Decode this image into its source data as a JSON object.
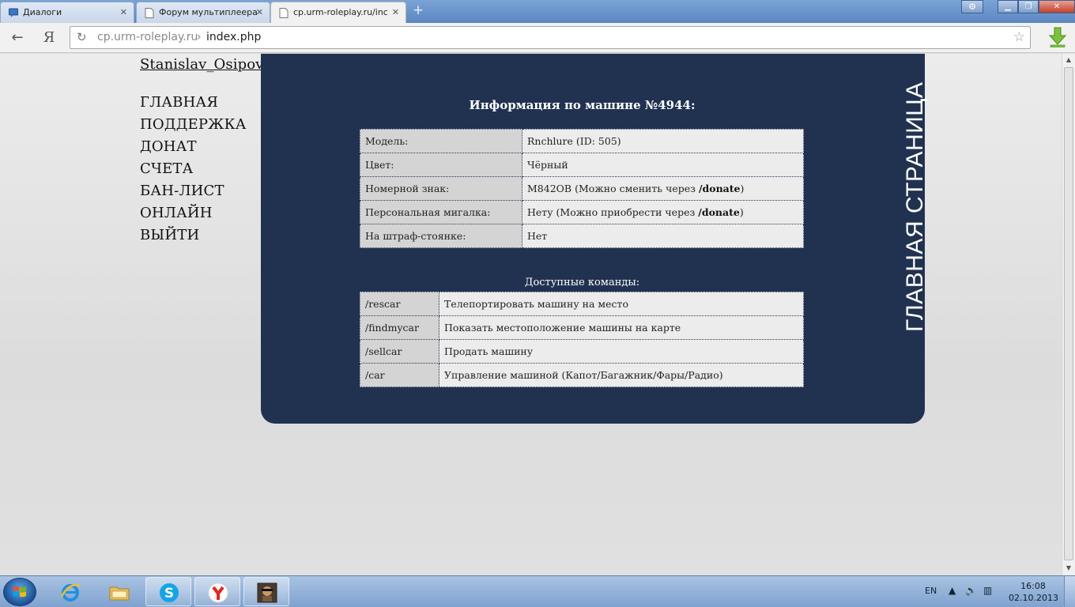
{
  "browser": {
    "tabs": [
      {
        "label": "Диалоги",
        "active": false
      },
      {
        "label": "Форум мультиплеера",
        "active": false
      },
      {
        "label": "cp.urm-roleplay.ru/inc",
        "active": true
      }
    ],
    "new_tab_symbol": "+",
    "url_host": "cp.urm-roleplay.ru",
    "url_separator": "›",
    "url_path": "index.php",
    "back_symbol": "←",
    "yandex_symbol": "Я",
    "reload_symbol": "↻",
    "star_symbol": "☆"
  },
  "sidebar": {
    "username": "Stanislav_Osipov",
    "items": [
      {
        "label": "ГЛАВНАЯ"
      },
      {
        "label": "ПОДДЕРЖКА"
      },
      {
        "label": "ДОНАТ"
      },
      {
        "label": "СЧЕТА"
      },
      {
        "label": "БАН-ЛИСТ"
      },
      {
        "label": "ОНЛАЙН"
      },
      {
        "label": "ВЫЙТИ"
      }
    ]
  },
  "main": {
    "vertical_title": "ГЛАВНАЯ СТРАНИЦА",
    "info_title": "Информация по машине №4944:",
    "info_rows": [
      {
        "key": "Модель:",
        "value": "Rnchlure (ID: 505)",
        "suffix": "",
        "bold": "",
        "tail": ""
      },
      {
        "key": "Цвет:",
        "value": "Чёрный",
        "suffix": "",
        "bold": "",
        "tail": ""
      },
      {
        "key": "Номерной знак:",
        "value": "M842OB (Можно сменить через ",
        "bold": "/donate",
        "tail": ")"
      },
      {
        "key": "Персональная мигалка:",
        "value": "Нету (Можно приобрести через ",
        "bold": "/donate",
        "tail": ")"
      },
      {
        "key": "На штраф-стоянке:",
        "value": "Нет",
        "bold": "",
        "tail": ""
      }
    ],
    "commands_title": "Доступные команды:",
    "commands": [
      {
        "cmd": "/rescar",
        "desc": "Телепортировать машину на место"
      },
      {
        "cmd": "/findmycar",
        "desc": "Показать местоположение машины на карте"
      },
      {
        "cmd": "/sellcar",
        "desc": "Продать машину"
      },
      {
        "cmd": "/car",
        "desc": "Управление машиной (Капот/Багажник/Фары/Радио)"
      }
    ]
  },
  "taskbar": {
    "language": "EN",
    "time": "16:08",
    "date": "02.10.2013",
    "apps": [
      "internet-explorer",
      "file-explorer",
      "skype",
      "yandex-browser",
      "game-app"
    ]
  },
  "colors": {
    "panel": "#213251",
    "page_bg": "#dcdcdc",
    "taskbar": "#8fb0d9"
  }
}
